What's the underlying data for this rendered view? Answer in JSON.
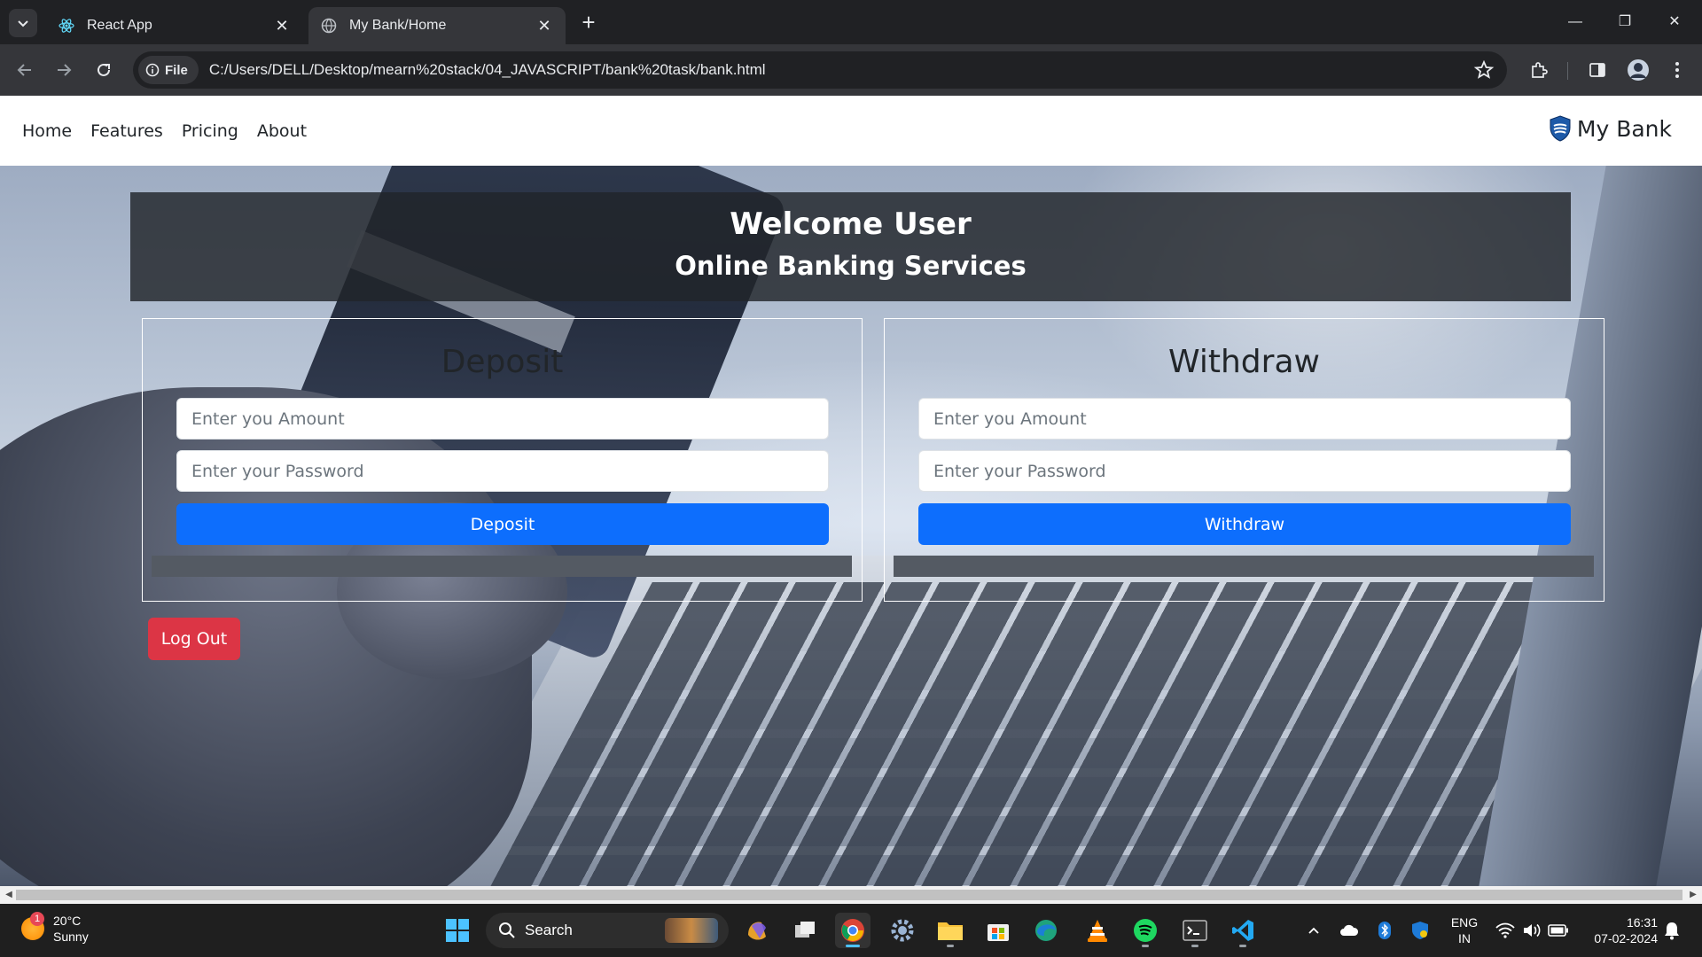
{
  "browser": {
    "tabs": [
      {
        "title": "React App",
        "active": false
      },
      {
        "title": "My Bank/Home",
        "active": true
      }
    ],
    "site_chip": "File",
    "url": "C:/Users/DELL/Desktop/mearn%20stack/04_JAVASCRIPT/bank%20task/bank.html"
  },
  "navbar": {
    "links": [
      "Home",
      "Features",
      "Pricing",
      "About"
    ],
    "brand": "My Bank"
  },
  "welcome": {
    "title": "Welcome User",
    "subtitle": "Online Banking Services"
  },
  "deposit": {
    "title": "Deposit",
    "amount_placeholder": "Enter you Amount",
    "password_placeholder": "Enter your Password",
    "button": "Deposit"
  },
  "withdraw": {
    "title": "Withdraw",
    "amount_placeholder": "Enter you Amount",
    "password_placeholder": "Enter your Password",
    "button": "Withdraw"
  },
  "logout": "Log Out",
  "taskbar": {
    "weather_temp": "20°C",
    "weather_cond": "Sunny",
    "weather_badge": "1",
    "search": "Search",
    "lang_top": "ENG",
    "lang_bottom": "IN",
    "time": "16:31",
    "date": "07-02-2024"
  },
  "colors": {
    "primary": "#0d6efd",
    "danger": "#dc3545",
    "dark_overlay": "#212529"
  }
}
